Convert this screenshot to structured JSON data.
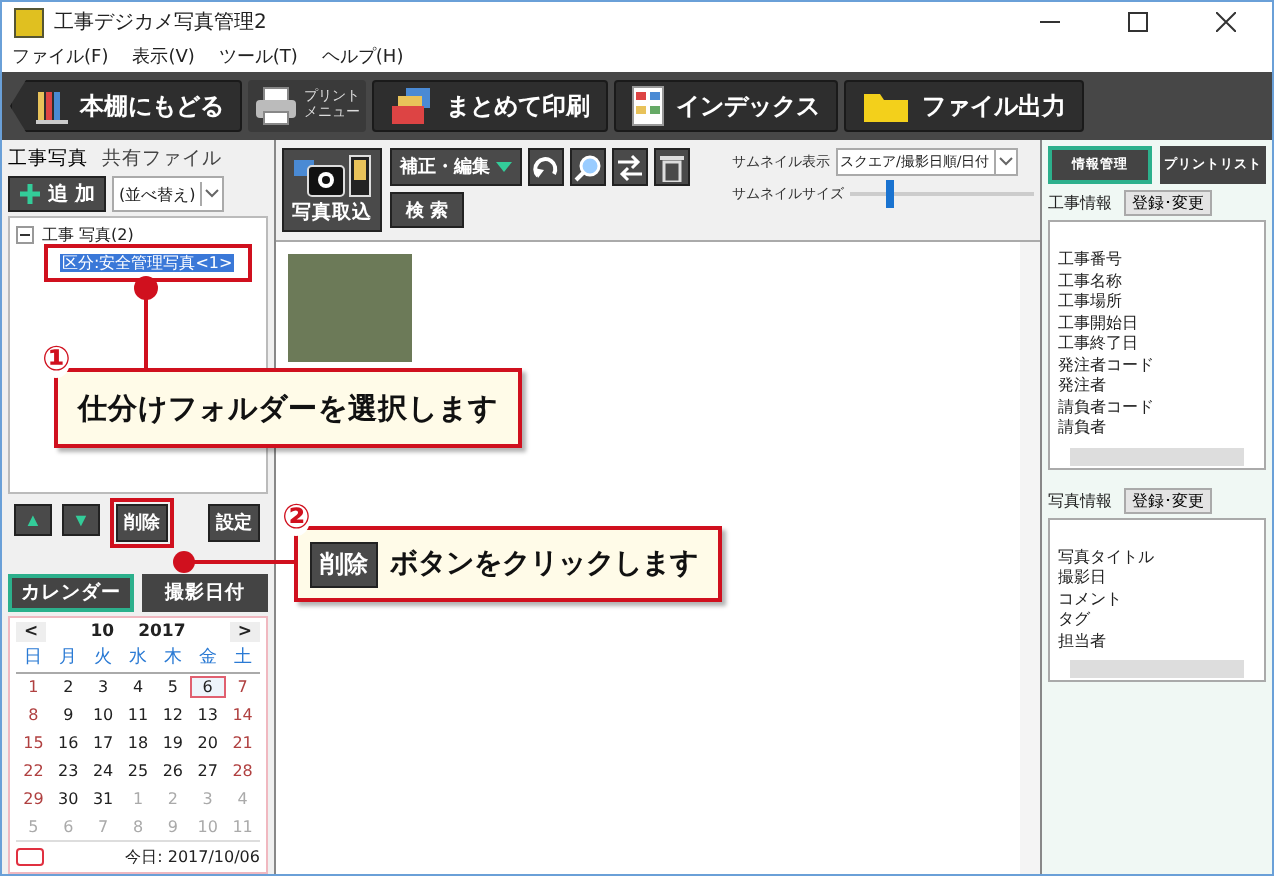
{
  "window": {
    "title": "工事デジカメ写真管理2"
  },
  "menu": [
    "ファイル(F)",
    "表示(V)",
    "ツール(T)",
    "ヘルプ(H)"
  ],
  "toolbar": [
    {
      "kind": "back",
      "label": "本棚にもどる"
    },
    {
      "kind": "print-menu",
      "lines": [
        "プリント",
        "メニュー"
      ]
    },
    {
      "kind": "print",
      "label": "まとめて印刷"
    },
    {
      "kind": "index",
      "label": "インデックス"
    },
    {
      "kind": "export",
      "label": "ファイル出力"
    }
  ],
  "left": {
    "tabs": [
      {
        "label": "工事写真",
        "selected": true
      },
      {
        "label": "共有ファイル",
        "selected": false
      }
    ],
    "add_button": "追 加",
    "sort": "(並べ替え)",
    "tree": {
      "label": "工事 写真(2)",
      "expanded": true,
      "children": [
        {
          "label": "区分:安全管理写真<1>",
          "selected": true
        }
      ]
    },
    "order_buttons": [
      "▲",
      "▼"
    ],
    "delete_button": "削除",
    "settings_button": "設定",
    "view_tabs": [
      {
        "label": "カレンダー",
        "selected": true
      },
      {
        "label": "撮影日付",
        "selected": false
      }
    ],
    "calendar": {
      "prev": "<",
      "next": ">",
      "month": "10",
      "year": "2017",
      "weekdays": [
        "日",
        "月",
        "火",
        "水",
        "木",
        "金",
        "土"
      ],
      "days": [
        {
          "d": "1",
          "other": false,
          "selected": false
        },
        {
          "d": "2",
          "other": false,
          "selected": false
        },
        {
          "d": "3",
          "other": false,
          "selected": false
        },
        {
          "d": "4",
          "other": false,
          "selected": false
        },
        {
          "d": "5",
          "other": false,
          "selected": false
        },
        {
          "d": "6",
          "other": false,
          "selected": true
        },
        {
          "d": "7",
          "other": false,
          "selected": false
        },
        {
          "d": "8",
          "other": false,
          "selected": false
        },
        {
          "d": "9",
          "other": false,
          "selected": false
        },
        {
          "d": "10",
          "other": false,
          "selected": false
        },
        {
          "d": "11",
          "other": false,
          "selected": false
        },
        {
          "d": "12",
          "other": false,
          "selected": false
        },
        {
          "d": "13",
          "other": false,
          "selected": false
        },
        {
          "d": "14",
          "other": false,
          "selected": false
        },
        {
          "d": "15",
          "other": false,
          "selected": false
        },
        {
          "d": "16",
          "other": false,
          "selected": false
        },
        {
          "d": "17",
          "other": false,
          "selected": false
        },
        {
          "d": "18",
          "other": false,
          "selected": false
        },
        {
          "d": "19",
          "other": false,
          "selected": false
        },
        {
          "d": "20",
          "other": false,
          "selected": false
        },
        {
          "d": "21",
          "other": false,
          "selected": false
        },
        {
          "d": "22",
          "other": false,
          "selected": false
        },
        {
          "d": "23",
          "other": false,
          "selected": false
        },
        {
          "d": "24",
          "other": false,
          "selected": false
        },
        {
          "d": "25",
          "other": false,
          "selected": false
        },
        {
          "d": "26",
          "other": false,
          "selected": false
        },
        {
          "d": "27",
          "other": false,
          "selected": false
        },
        {
          "d": "28",
          "other": false,
          "selected": false
        },
        {
          "d": "29",
          "other": false,
          "selected": false
        },
        {
          "d": "30",
          "other": false,
          "selected": false
        },
        {
          "d": "31",
          "other": false,
          "selected": false
        },
        {
          "d": "1",
          "other": true,
          "selected": false
        },
        {
          "d": "2",
          "other": true,
          "selected": false
        },
        {
          "d": "3",
          "other": true,
          "selected": false
        },
        {
          "d": "4",
          "other": true,
          "selected": false
        },
        {
          "d": "5",
          "other": true,
          "selected": false
        },
        {
          "d": "6",
          "other": true,
          "selected": false
        },
        {
          "d": "7",
          "other": true,
          "selected": false
        },
        {
          "d": "8",
          "other": true,
          "selected": false
        },
        {
          "d": "9",
          "other": true,
          "selected": false
        },
        {
          "d": "10",
          "other": true,
          "selected": false
        },
        {
          "d": "11",
          "other": true,
          "selected": false
        }
      ],
      "today": "今日: 2017/10/06"
    }
  },
  "middle": {
    "import_button": "写真取込",
    "edit_button": "補正・編集",
    "search_button": "検 索",
    "thumb_display_label": "サムネイル表示",
    "thumb_display_value": "スクエア/撮影日順/日付",
    "thumb_size_label": "サムネイルサイズ",
    "thumb_size": {
      "level": 0.2
    }
  },
  "right": {
    "tabs": [
      {
        "label": "情報管理",
        "selected": true
      },
      {
        "label": "プリントリスト",
        "selected": false
      }
    ],
    "sections": [
      {
        "title": "工事情報",
        "button": "登録･変更",
        "items": [
          "工事番号",
          "工事名称",
          "工事場所",
          "工事開始日",
          "工事終了日",
          "発注者コード",
          "発注者",
          "請負者コード",
          "請負者"
        ]
      },
      {
        "title": "写真情報",
        "button": "登録･変更",
        "items": [
          "写真タイトル",
          "撮影日",
          "コメント",
          "タグ",
          "担当者"
        ]
      }
    ]
  },
  "callouts": [
    {
      "number": "①",
      "text": "仕分けフォルダーを選択します"
    },
    {
      "number": "②",
      "button": "削除",
      "text": "ボタンをクリックします"
    }
  ]
}
